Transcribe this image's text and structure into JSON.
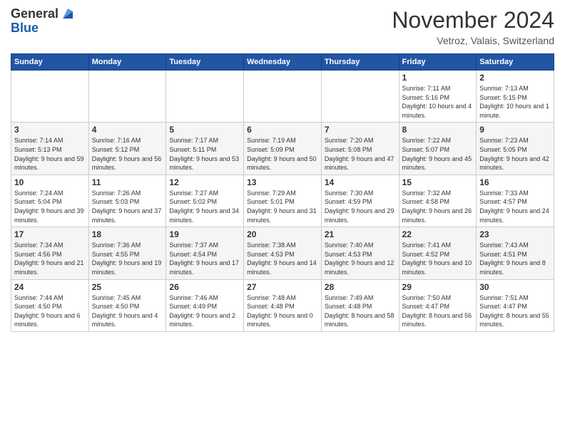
{
  "logo": {
    "line1": "General",
    "line2": "Blue"
  },
  "title": "November 2024",
  "location": "Vetroz, Valais, Switzerland",
  "days_of_week": [
    "Sunday",
    "Monday",
    "Tuesday",
    "Wednesday",
    "Thursday",
    "Friday",
    "Saturday"
  ],
  "weeks": [
    [
      {
        "day": "",
        "info": ""
      },
      {
        "day": "",
        "info": ""
      },
      {
        "day": "",
        "info": ""
      },
      {
        "day": "",
        "info": ""
      },
      {
        "day": "",
        "info": ""
      },
      {
        "day": "1",
        "info": "Sunrise: 7:11 AM\nSunset: 5:16 PM\nDaylight: 10 hours and 4 minutes."
      },
      {
        "day": "2",
        "info": "Sunrise: 7:13 AM\nSunset: 5:15 PM\nDaylight: 10 hours and 1 minute."
      }
    ],
    [
      {
        "day": "3",
        "info": "Sunrise: 7:14 AM\nSunset: 5:13 PM\nDaylight: 9 hours and 59 minutes."
      },
      {
        "day": "4",
        "info": "Sunrise: 7:16 AM\nSunset: 5:12 PM\nDaylight: 9 hours and 56 minutes."
      },
      {
        "day": "5",
        "info": "Sunrise: 7:17 AM\nSunset: 5:11 PM\nDaylight: 9 hours and 53 minutes."
      },
      {
        "day": "6",
        "info": "Sunrise: 7:19 AM\nSunset: 5:09 PM\nDaylight: 9 hours and 50 minutes."
      },
      {
        "day": "7",
        "info": "Sunrise: 7:20 AM\nSunset: 5:08 PM\nDaylight: 9 hours and 47 minutes."
      },
      {
        "day": "8",
        "info": "Sunrise: 7:22 AM\nSunset: 5:07 PM\nDaylight: 9 hours and 45 minutes."
      },
      {
        "day": "9",
        "info": "Sunrise: 7:23 AM\nSunset: 5:05 PM\nDaylight: 9 hours and 42 minutes."
      }
    ],
    [
      {
        "day": "10",
        "info": "Sunrise: 7:24 AM\nSunset: 5:04 PM\nDaylight: 9 hours and 39 minutes."
      },
      {
        "day": "11",
        "info": "Sunrise: 7:26 AM\nSunset: 5:03 PM\nDaylight: 9 hours and 37 minutes."
      },
      {
        "day": "12",
        "info": "Sunrise: 7:27 AM\nSunset: 5:02 PM\nDaylight: 9 hours and 34 minutes."
      },
      {
        "day": "13",
        "info": "Sunrise: 7:29 AM\nSunset: 5:01 PM\nDaylight: 9 hours and 31 minutes."
      },
      {
        "day": "14",
        "info": "Sunrise: 7:30 AM\nSunset: 4:59 PM\nDaylight: 9 hours and 29 minutes."
      },
      {
        "day": "15",
        "info": "Sunrise: 7:32 AM\nSunset: 4:58 PM\nDaylight: 9 hours and 26 minutes."
      },
      {
        "day": "16",
        "info": "Sunrise: 7:33 AM\nSunset: 4:57 PM\nDaylight: 9 hours and 24 minutes."
      }
    ],
    [
      {
        "day": "17",
        "info": "Sunrise: 7:34 AM\nSunset: 4:56 PM\nDaylight: 9 hours and 21 minutes."
      },
      {
        "day": "18",
        "info": "Sunrise: 7:36 AM\nSunset: 4:55 PM\nDaylight: 9 hours and 19 minutes."
      },
      {
        "day": "19",
        "info": "Sunrise: 7:37 AM\nSunset: 4:54 PM\nDaylight: 9 hours and 17 minutes."
      },
      {
        "day": "20",
        "info": "Sunrise: 7:38 AM\nSunset: 4:53 PM\nDaylight: 9 hours and 14 minutes."
      },
      {
        "day": "21",
        "info": "Sunrise: 7:40 AM\nSunset: 4:53 PM\nDaylight: 9 hours and 12 minutes."
      },
      {
        "day": "22",
        "info": "Sunrise: 7:41 AM\nSunset: 4:52 PM\nDaylight: 9 hours and 10 minutes."
      },
      {
        "day": "23",
        "info": "Sunrise: 7:43 AM\nSunset: 4:51 PM\nDaylight: 9 hours and 8 minutes."
      }
    ],
    [
      {
        "day": "24",
        "info": "Sunrise: 7:44 AM\nSunset: 4:50 PM\nDaylight: 9 hours and 6 minutes."
      },
      {
        "day": "25",
        "info": "Sunrise: 7:45 AM\nSunset: 4:50 PM\nDaylight: 9 hours and 4 minutes."
      },
      {
        "day": "26",
        "info": "Sunrise: 7:46 AM\nSunset: 4:49 PM\nDaylight: 9 hours and 2 minutes."
      },
      {
        "day": "27",
        "info": "Sunrise: 7:48 AM\nSunset: 4:48 PM\nDaylight: 9 hours and 0 minutes."
      },
      {
        "day": "28",
        "info": "Sunrise: 7:49 AM\nSunset: 4:48 PM\nDaylight: 8 hours and 58 minutes."
      },
      {
        "day": "29",
        "info": "Sunrise: 7:50 AM\nSunset: 4:47 PM\nDaylight: 8 hours and 56 minutes."
      },
      {
        "day": "30",
        "info": "Sunrise: 7:51 AM\nSunset: 4:47 PM\nDaylight: 8 hours and 55 minutes."
      }
    ]
  ]
}
